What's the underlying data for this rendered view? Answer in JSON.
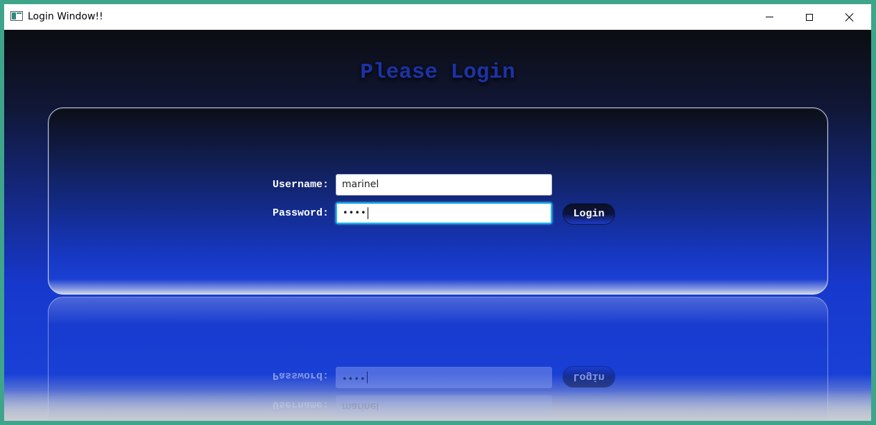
{
  "window": {
    "title": "Login Window!!",
    "buttons": {
      "minimize": "minimize-icon",
      "maximize": "maximize-icon",
      "close": "close-icon"
    }
  },
  "heading": "Please Login",
  "form": {
    "username_label": "Username:",
    "username_value": "marinel",
    "password_label": "Password:",
    "password_value": "••••",
    "login_button": "Login"
  },
  "colors": {
    "heading": "#1c33a6",
    "background_top": "#0c0d12",
    "background_bottom": "#1940d6",
    "focus_ring": "#1fb6ee"
  }
}
